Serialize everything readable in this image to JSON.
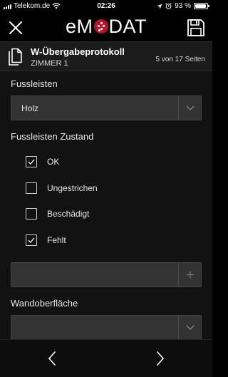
{
  "status_bar": {
    "carrier": "Telekom.de",
    "time": "02:26",
    "battery_text": "93 %",
    "battery_level": 0.93
  },
  "header": {
    "brand": {
      "pre": "e",
      "post": "DAT",
      "letter_m": "M"
    },
    "close_icon": "close-icon",
    "save_icon": "save-icon"
  },
  "document": {
    "title": "W-Übergabeprotokoll",
    "subtitle": "ZIMMER 1",
    "pages": "5 von 17 Seiten"
  },
  "form": {
    "fussleisten": {
      "label": "Fussleisten",
      "value": "Holz"
    },
    "zustand": {
      "label": "Fussleisten Zustand",
      "options": [
        {
          "label": "OK",
          "checked": true
        },
        {
          "label": "Ungestrichen",
          "checked": false
        },
        {
          "label": "Beschädigt",
          "checked": false
        },
        {
          "label": "Fehlt",
          "checked": true
        }
      ],
      "add_value": "",
      "add_placeholder": ""
    },
    "wandoberflaeche": {
      "label": "Wandoberfläche",
      "value": ""
    }
  },
  "colors": {
    "brand_accent": "#b5162b",
    "background": "#121212",
    "field_bg": "#333333"
  }
}
